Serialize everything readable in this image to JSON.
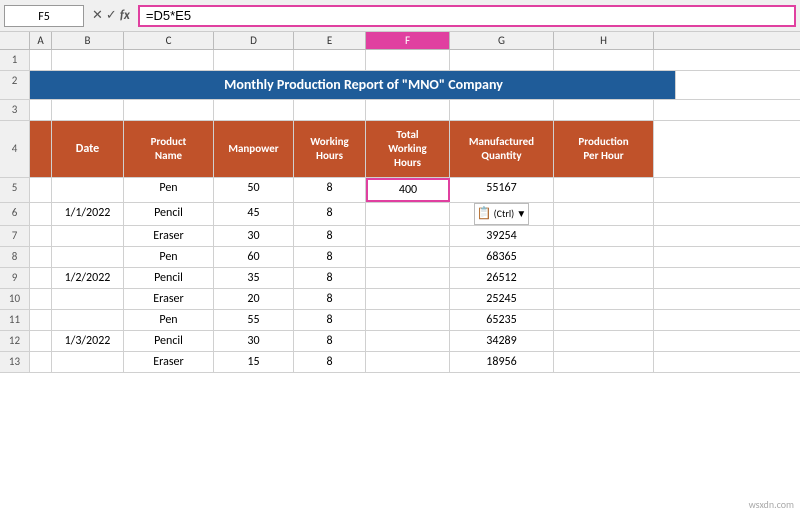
{
  "formula_bar": {
    "cell_ref": "F5",
    "formula": "=D5*E5",
    "icon_x": "✕",
    "icon_check": "✓",
    "icon_fx": "fx"
  },
  "col_headers": [
    "A",
    "B",
    "C",
    "D",
    "E",
    "F",
    "G",
    "H"
  ],
  "title": "Monthly Production Report of \"MNO\" Company",
  "headers": {
    "date": "Date",
    "product_name": "Product\nName",
    "manpower": "Manpower",
    "working_hours": "Working\nHours",
    "total_working_hours": "Total\nWorking\nHours",
    "manufactured_quantity": "Manufactured\nQuantity",
    "production_per_hour": "Production\nPer Hour"
  },
  "rows": [
    {
      "row": 5,
      "date": "",
      "product": "Pen",
      "manpower": "50",
      "working_hours": "8",
      "total_wh": "400",
      "mfg_qty": "55167",
      "prod_per_hr": ""
    },
    {
      "row": 6,
      "date": "1/1/2022",
      "product": "Pencil",
      "manpower": "45",
      "working_hours": "8",
      "total_wh": "",
      "mfg_qty": "",
      "prod_per_hr": ""
    },
    {
      "row": 7,
      "date": "",
      "product": "Eraser",
      "manpower": "30",
      "working_hours": "8",
      "total_wh": "",
      "mfg_qty": "39254",
      "prod_per_hr": ""
    },
    {
      "row": 8,
      "date": "",
      "product": "Pen",
      "manpower": "60",
      "working_hours": "8",
      "total_wh": "",
      "mfg_qty": "68365",
      "prod_per_hr": ""
    },
    {
      "row": 9,
      "date": "1/2/2022",
      "product": "Pencil",
      "manpower": "35",
      "working_hours": "8",
      "total_wh": "",
      "mfg_qty": "26512",
      "prod_per_hr": ""
    },
    {
      "row": 10,
      "date": "",
      "product": "Eraser",
      "manpower": "20",
      "working_hours": "8",
      "total_wh": "",
      "mfg_qty": "25245",
      "prod_per_hr": ""
    },
    {
      "row": 11,
      "date": "",
      "product": "Pen",
      "manpower": "55",
      "working_hours": "8",
      "total_wh": "",
      "mfg_qty": "65235",
      "prod_per_hr": ""
    },
    {
      "row": 12,
      "date": "1/3/2022",
      "product": "Pencil",
      "manpower": "30",
      "working_hours": "8",
      "total_wh": "",
      "mfg_qty": "34289",
      "prod_per_hr": ""
    },
    {
      "row": 13,
      "date": "",
      "product": "Eraser",
      "manpower": "15",
      "working_hours": "8",
      "total_wh": "",
      "mfg_qty": "18956",
      "prod_per_hr": ""
    }
  ],
  "paste_tooltip": "(Ctrl) ▼",
  "row_numbers": [
    1,
    2,
    3,
    4,
    5,
    6,
    7,
    8,
    9,
    10,
    11,
    12,
    13
  ],
  "colors": {
    "header_bg": "#1f5c99",
    "col_header_bg": "#c0522a",
    "selected_border": "#e040a0"
  }
}
